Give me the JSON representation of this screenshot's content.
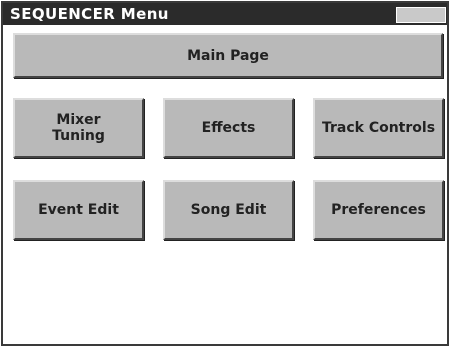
{
  "window": {
    "title": "SEQUENCER Menu"
  },
  "buttons": {
    "main_page": "Main Page",
    "mixer_tuning": "Mixer\nTuning",
    "effects": "Effects",
    "track_controls": "Track Controls",
    "event_edit": "Event Edit",
    "song_edit": "Song Edit",
    "preferences": "Preferences"
  },
  "colors": {
    "titlebar": "#2b2b2b",
    "button_face": "#b9b9b9",
    "background": "#ffffff"
  }
}
